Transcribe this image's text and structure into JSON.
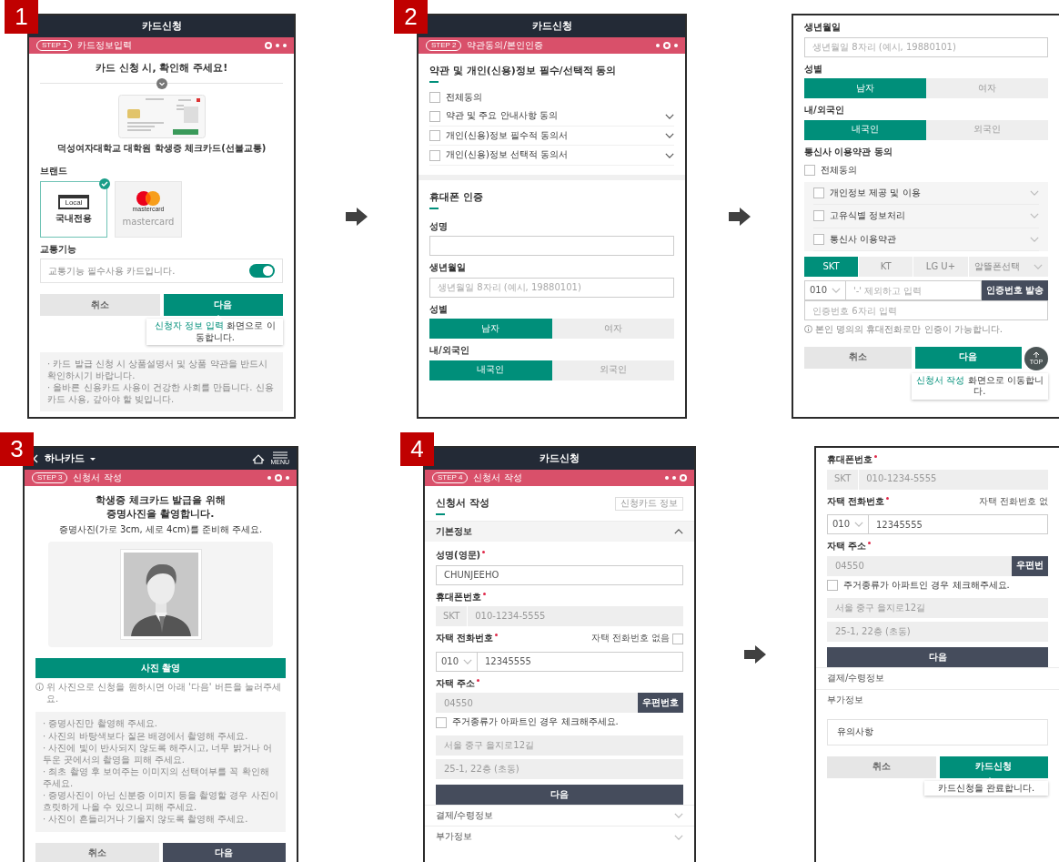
{
  "screens": [
    {
      "badge": "1",
      "arrow_before": false,
      "blocks": [
        {
          "kind": "titlebar",
          "title": "카드신청"
        },
        {
          "kind": "stepbar",
          "step": "STEP 1",
          "label": "카드정보입력",
          "steps": [
            {
              "selected": true
            },
            {
              "selected": false
            },
            {
              "selected": false
            }
          ]
        },
        {
          "kind": "center_title",
          "lines": [
            "카드 신청 시, 확인해 주세요!"
          ]
        },
        {
          "kind": "collapse_divider"
        },
        {
          "kind": "card_art"
        },
        {
          "kind": "caption",
          "text": "덕성여자대학교 대학원 학생증 체크카드(선불교통)"
        },
        {
          "kind": "label",
          "text": "브랜드"
        },
        {
          "kind": "brand_tiles",
          "items": [
            {
              "kind": "local",
              "badge": "Local",
              "label": "국내전용",
              "selected": true
            },
            {
              "kind": "mastercard",
              "badge": "mastercard",
              "label": "mastercard",
              "selected": false
            }
          ]
        },
        {
          "kind": "label",
          "text": "교통기능"
        },
        {
          "kind": "toggle_row",
          "text": "교통기능 필수사용 카드입니다.",
          "on": true
        },
        {
          "kind": "button_pair",
          "buttons": [
            {
              "label": "취소",
              "kind": "light"
            },
            {
              "label": "다음",
              "kind": "primary"
            }
          ],
          "tooltip": {
            "highlight": "신청자 정보 입력",
            "text": " 화면으로 이동합니다."
          }
        },
        {
          "kind": "notes",
          "items": [
            "· 카드 발급 신청 시 상품설명서 및 상품 약관을 반드시 확인하시기 바랍니다.",
            "· 올바른 신용카드 사용이 건강한 사회를 만듭니다. 신용카드 사용, 갚아야 할 빚입니다."
          ]
        }
      ]
    },
    {
      "badge": "2",
      "arrow_before": true,
      "blocks": [
        {
          "kind": "titlebar",
          "title": "카드신청"
        },
        {
          "kind": "stepbar",
          "step": "STEP 2",
          "label": "약관동의/본인인증",
          "steps": [
            {
              "selected": false
            },
            {
              "selected": true
            },
            {
              "selected": false
            }
          ]
        },
        {
          "kind": "section_title",
          "text": "약관 및 개인(신용)정보 필수/선택적 동의"
        },
        {
          "kind": "check_row",
          "text": "전체동의",
          "checked": false,
          "expandable": false
        },
        {
          "kind": "check_row",
          "text": "약관 및 주요 안내사항 동의",
          "checked": false,
          "expandable": true
        },
        {
          "kind": "check_row",
          "text": "개인(신용)정보 필수적 동의서",
          "checked": false,
          "expandable": true
        },
        {
          "kind": "check_row",
          "text": "개인(신용)정보 선택적 동의서",
          "checked": false,
          "expandable": true
        },
        {
          "kind": "separator"
        },
        {
          "kind": "section_title",
          "text": "휴대폰 인증"
        },
        {
          "kind": "label",
          "text": "성명"
        },
        {
          "kind": "input"
        },
        {
          "kind": "label",
          "text": "생년월일"
        },
        {
          "kind": "input",
          "placeholder": "생년월일 8자리 (예시, 19880101)"
        },
        {
          "kind": "label",
          "text": "성별"
        },
        {
          "kind": "segmented",
          "options": [
            {
              "label": "남자",
              "selected": true
            },
            {
              "label": "여자",
              "selected": false
            }
          ]
        },
        {
          "kind": "label",
          "text": "내/외국인"
        },
        {
          "kind": "segmented",
          "options": [
            {
              "label": "내국인",
              "selected": true
            },
            {
              "label": "외국인",
              "selected": false
            }
          ]
        }
      ]
    },
    {
      "arrow_before": true,
      "blocks": [
        {
          "kind": "label",
          "text": "생년월일"
        },
        {
          "kind": "input",
          "placeholder": "생년월일 8자리 (예시, 19880101)"
        },
        {
          "kind": "label",
          "text": "성별"
        },
        {
          "kind": "segmented",
          "options": [
            {
              "label": "남자",
              "selected": true
            },
            {
              "label": "여자",
              "selected": false
            }
          ]
        },
        {
          "kind": "label",
          "text": "내/외국인"
        },
        {
          "kind": "segmented",
          "options": [
            {
              "label": "내국인",
              "selected": true
            },
            {
              "label": "외국인",
              "selected": false
            }
          ]
        },
        {
          "kind": "label",
          "text": "통신사 이용약관 동의"
        },
        {
          "kind": "check_row",
          "text": "전체동의",
          "checked": false,
          "expandable": false
        },
        {
          "kind": "check_group",
          "items": [
            {
              "text": "개인정보 제공 및 이용",
              "checked": false
            },
            {
              "text": "고유식별 정보처리",
              "checked": false
            },
            {
              "text": "통신사 이용약관",
              "checked": false
            }
          ]
        },
        {
          "kind": "carrier_tabs",
          "items": [
            {
              "label": "SKT",
              "selected": true
            },
            {
              "label": "KT",
              "selected": false
            },
            {
              "label": "LG U+",
              "selected": false
            }
          ],
          "select": "알뜰폰선택"
        },
        {
          "kind": "phone_row",
          "prefix": "010",
          "placeholder": "'-' 제외하고 입력",
          "button": "인증번호 발송"
        },
        {
          "kind": "input",
          "placeholder": "인증번호 6자리 입력"
        },
        {
          "kind": "info_note",
          "text": "본인 명의의 휴대전화로만 인증이 가능합니다."
        },
        {
          "kind": "button_pair",
          "buttons": [
            {
              "label": "취소",
              "kind": "light"
            },
            {
              "label": "다음",
              "kind": "primary"
            }
          ],
          "top": "TOP",
          "tooltip": {
            "highlight": "신청서 작성",
            "text": " 화면으로 이동합니다."
          }
        }
      ]
    },
    {
      "badge": "3",
      "arrow_before": false,
      "blocks": [
        {
          "kind": "appnav",
          "title": "하나카드",
          "menu": "MENU"
        },
        {
          "kind": "stepbar",
          "step": "STEP 3",
          "label": "신청서 작성",
          "steps": [
            {
              "selected": false
            },
            {
              "selected": true
            },
            {
              "selected": false
            }
          ]
        },
        {
          "kind": "center_title",
          "lines": [
            "학생증 체크카드 발급을 위해",
            "증명사진을 촬영합니다."
          ]
        },
        {
          "kind": "subtitle",
          "text": "증명사진(가로 3cm, 세로 4cm)를 준비해 주세요."
        },
        {
          "kind": "photo_frame"
        },
        {
          "kind": "wide_primary",
          "label": "사진 촬영"
        },
        {
          "kind": "info_note",
          "text": "위 사진으로 신청을 원하시면 아래 '다음' 버튼을 눌러주세요."
        },
        {
          "kind": "notes",
          "items": [
            "· 증명사진만 촬영해 주세요.",
            "· 사진의 바탕색보다 짙은 배경에서 촬영해 주세요.",
            "· 사진에 빛이 반사되지 않도록 해주시고, 너무 밝거나 어두운 곳에서의 촬영을 피해 주세요.",
            "· 최초 촬영 후 보여주는 이미지의 선택여부를 꼭 확인해 주세요.",
            "· 증명사진이 아닌 신분증 이미지 등을 촬영할 경우 사진이 흐릿하게 나올 수 있으니 피해 주세요.",
            "· 사진이 흔들리거나 기울지 않도록 촬영해 주세요."
          ]
        },
        {
          "kind": "button_pair",
          "buttons": [
            {
              "label": "취소",
              "kind": "light"
            },
            {
              "label": "다음",
              "kind": "dark"
            }
          ]
        }
      ]
    },
    {
      "badge": "4",
      "arrow_before": false,
      "blocks": [
        {
          "kind": "titlebar",
          "title": "카드신청"
        },
        {
          "kind": "stepbar",
          "step": "STEP 4",
          "label": "신청서 작성",
          "steps": [
            {
              "selected": false
            },
            {
              "selected": false
            },
            {
              "selected": true
            }
          ]
        },
        {
          "kind": "header_row",
          "title": "신청서 작성",
          "button": "신청카드 정보"
        },
        {
          "kind": "accordion",
          "label": "기본정보",
          "expanded": true
        },
        {
          "kind": "label",
          "text": "성명(영문)",
          "required": true
        },
        {
          "kind": "input",
          "value": "CHUNJEEHO"
        },
        {
          "kind": "label",
          "text": "휴대폰번호",
          "required": true
        },
        {
          "kind": "readonly_pair",
          "values": [
            "SKT",
            "010-1234-5555"
          ]
        },
        {
          "kind": "label_check",
          "text": "자택 전화번호",
          "required": true,
          "option": "자택 전화번호 없음",
          "checked": false
        },
        {
          "kind": "select_input",
          "prefix": "010",
          "value": "12345555"
        },
        {
          "kind": "label",
          "text": "자택 주소",
          "required": true
        },
        {
          "kind": "input_button",
          "value": "04550",
          "button": "우편번호"
        },
        {
          "kind": "check_line",
          "text": "주거종류가 아파트인 경우 체크해주세요.",
          "checked": false
        },
        {
          "kind": "readonly",
          "value": "서울 중구 을지로12길"
        },
        {
          "kind": "readonly",
          "value": "25-1, 22층 (초동)"
        },
        {
          "kind": "wide_dark",
          "label": "다음"
        },
        {
          "kind": "accordion",
          "label": "결제/수령정보",
          "expanded": false
        },
        {
          "kind": "accordion",
          "label": "부가정보",
          "expanded": false
        }
      ]
    },
    {
      "arrow_before": true,
      "blocks": [
        {
          "kind": "label",
          "text": "휴대폰번호",
          "required": true
        },
        {
          "kind": "readonly_pair",
          "values": [
            "SKT",
            "010-1234-5555"
          ]
        },
        {
          "kind": "label_check",
          "text": "자택 전화번호",
          "required": true,
          "option": "자택 전화번호 없"
        },
        {
          "kind": "select_input",
          "prefix": "010",
          "value": "12345555"
        },
        {
          "kind": "label",
          "text": "자택 주소",
          "required": true
        },
        {
          "kind": "input_button",
          "value": "04550",
          "button": "우편번"
        },
        {
          "kind": "check_line",
          "text": "주거종류가 아파트인 경우 체크해주세요.",
          "checked": false
        },
        {
          "kind": "readonly",
          "value": "서울 중구 을지로12길"
        },
        {
          "kind": "readonly",
          "value": "25-1, 22층 (초동)"
        },
        {
          "kind": "wide_dark",
          "label": "다음"
        },
        {
          "kind": "accordion",
          "label": "결제/수령정보"
        },
        {
          "kind": "accordion",
          "label": "부가정보"
        },
        {
          "kind": "boxed_select",
          "label": "유의사항"
        },
        {
          "kind": "button_pair",
          "buttons": [
            {
              "label": "취소",
              "kind": "light"
            },
            {
              "label": "카드신청",
              "kind": "primary"
            }
          ],
          "tooltip": {
            "text": "카드신청을 완료합니다."
          }
        }
      ]
    }
  ]
}
